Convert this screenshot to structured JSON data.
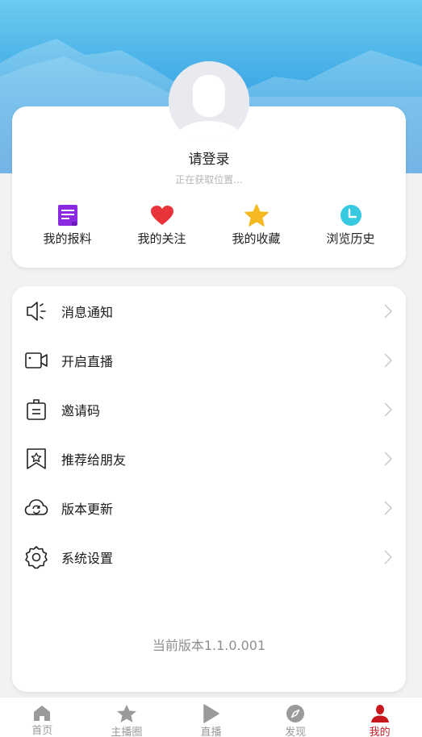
{
  "profile": {
    "login_text": "请登录",
    "location_text": "正在获取位置..."
  },
  "quick_actions": [
    {
      "label": "我的报料",
      "icon": "report-icon",
      "color": "#8a2be2"
    },
    {
      "label": "我的关注",
      "icon": "heart-icon",
      "color": "#e8333a"
    },
    {
      "label": "我的收藏",
      "icon": "star-icon",
      "color": "#f5b921"
    },
    {
      "label": "浏览历史",
      "icon": "clock-icon",
      "color": "#37c9e0"
    }
  ],
  "menu": [
    {
      "label": "消息通知",
      "icon": "speaker-icon"
    },
    {
      "label": "开启直播",
      "icon": "video-camera-icon"
    },
    {
      "label": "邀请码",
      "icon": "badge-icon"
    },
    {
      "label": "推荐给朋友",
      "icon": "bookmark-star-icon"
    },
    {
      "label": "版本更新",
      "icon": "cloud-refresh-icon"
    },
    {
      "label": "系统设置",
      "icon": "settings-gear-icon"
    }
  ],
  "version_text": "当前版本1.1.0.001",
  "tabbar": [
    {
      "label": "首页",
      "icon": "home-icon",
      "active": false
    },
    {
      "label": "主播圈",
      "icon": "star-icon",
      "active": false
    },
    {
      "label": "直播",
      "icon": "play-icon",
      "active": false
    },
    {
      "label": "发现",
      "icon": "compass-icon",
      "active": false
    },
    {
      "label": "我的",
      "icon": "user-icon",
      "active": true
    }
  ],
  "colors": {
    "header_top": "#6ccbf0",
    "header_bottom": "#2f8fda",
    "active_tab": "#c8161d",
    "inactive_tab": "#9a9a9a"
  }
}
